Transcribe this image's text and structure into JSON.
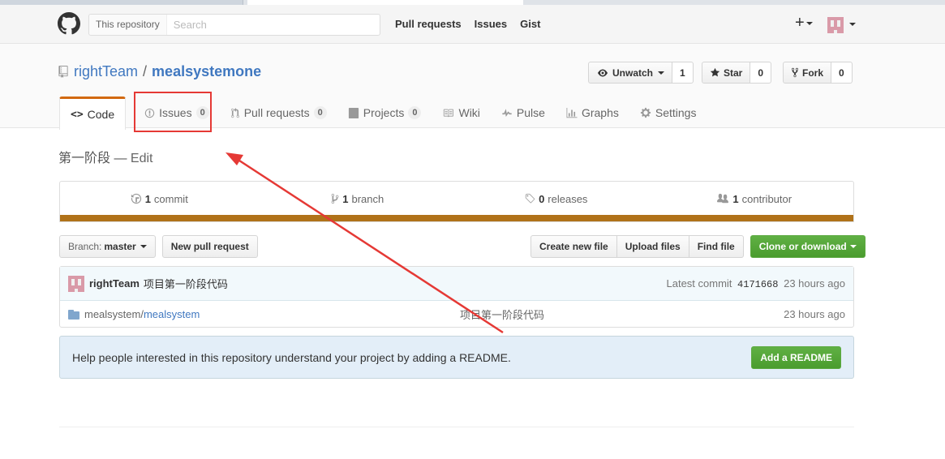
{
  "header": {
    "search_scope": "This repository",
    "search_placeholder": "Search",
    "nav": [
      "Pull requests",
      "Issues",
      "Gist"
    ],
    "plus_label": "+"
  },
  "repo": {
    "owner": "rightTeam",
    "separator": "/",
    "name": "mealsystemone",
    "watch_label": "Unwatch",
    "watch_count": "1",
    "star_label": "Star",
    "star_count": "0",
    "fork_label": "Fork",
    "fork_count": "0"
  },
  "tabs": {
    "code": "Code",
    "issues": "Issues",
    "issues_count": "0",
    "pulls": "Pull requests",
    "pulls_count": "0",
    "projects": "Projects",
    "projects_count": "0",
    "wiki": "Wiki",
    "pulse": "Pulse",
    "graphs": "Graphs",
    "settings": "Settings"
  },
  "description": {
    "text": "第一阶段 — ",
    "edit": "Edit"
  },
  "numbers": {
    "commits_count": "1",
    "commits_label": "commit",
    "branches_count": "1",
    "branches_label": "branch",
    "releases_count": "0",
    "releases_label": "releases",
    "contributors_count": "1",
    "contributors_label": "contributor"
  },
  "file_nav": {
    "branch_label": "Branch:",
    "branch_value": "master",
    "new_pr": "New pull request",
    "create_file": "Create new file",
    "upload_files": "Upload files",
    "find_file": "Find file",
    "clone": "Clone or download"
  },
  "commit": {
    "author": "rightTeam",
    "message": "项目第一阶段代码",
    "latest_label": "Latest commit",
    "sha": "4171668",
    "age": "23 hours ago"
  },
  "files": [
    {
      "dir": "mealsystem/",
      "name": "mealsystem",
      "message": "项目第一阶段代码",
      "age": "23 hours ago"
    }
  ],
  "readme": {
    "text": "Help people interested in this repository understand your project by adding a README.",
    "button": "Add a README"
  },
  "colors": {
    "accent_blue": "#4078c0",
    "language_bar": "#b07219",
    "green_button": "#55a532",
    "annotation_red": "#e53935"
  }
}
